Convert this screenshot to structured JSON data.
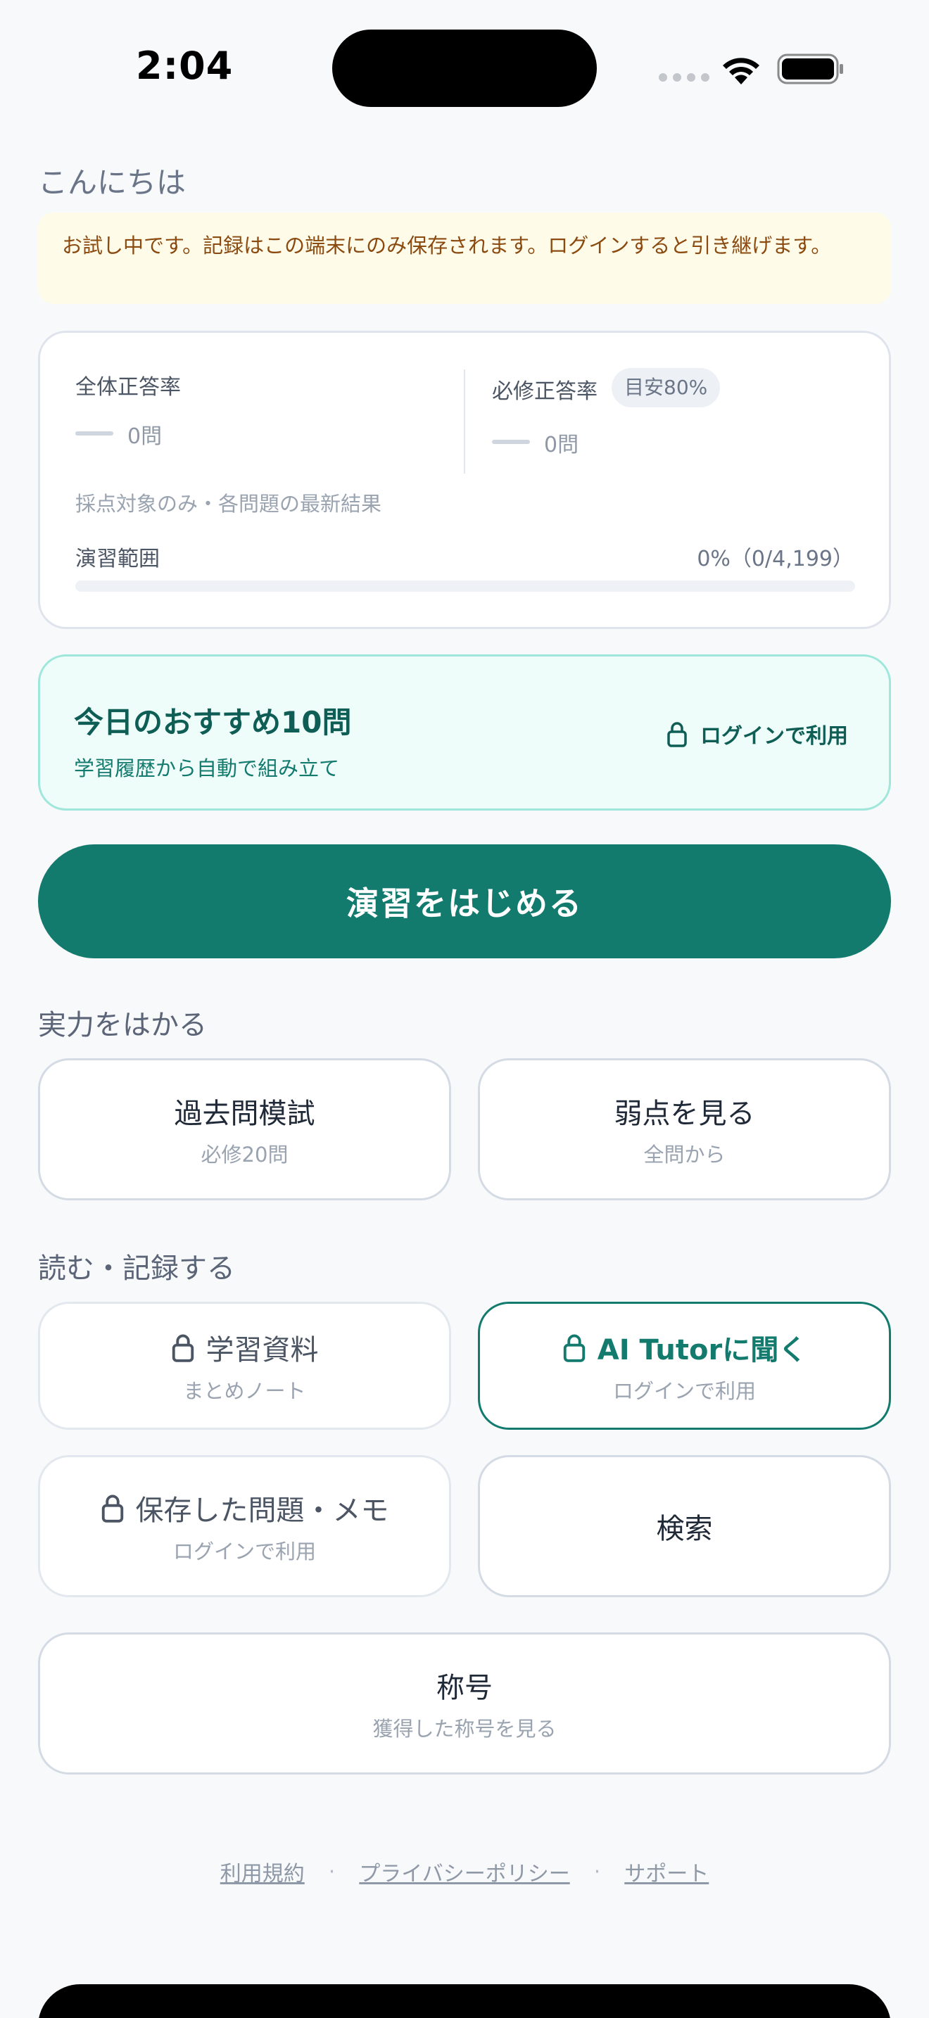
{
  "status_bar": {
    "time": "2:04"
  },
  "greeting": "こんにちは",
  "notice": "お試し中です。記録はこの端末にのみ保存されます。ログインすると引き継げます。",
  "stats": {
    "overall_label": "全体正答率",
    "overall_count": "0問",
    "required_label": "必修正答率",
    "goal_badge": "目安80%",
    "required_count": "0問",
    "note": "採点対象のみ・各問題の最新結果",
    "range_label": "演習範囲",
    "range_value": "0%（0/4,199）",
    "range_progress": 0
  },
  "recommend": {
    "title": "今日のおすすめ10問",
    "subtitle": "学習履歴から自動で組み立て",
    "lock_label": "ログインで利用"
  },
  "start_button": "演習をはじめる",
  "section_measure": {
    "title": "実力をはかる",
    "tiles": [
      {
        "title": "過去問模試",
        "sub": "必修20問"
      },
      {
        "title": "弱点を見る",
        "sub": "全問から"
      }
    ]
  },
  "section_read": {
    "title": "読む・記録する",
    "tiles": [
      {
        "title": "学習資料",
        "sub": "まとめノート"
      },
      {
        "title": "AI Tutorに聞く",
        "sub": "ログインで利用"
      },
      {
        "title": "保存した問題・メモ",
        "sub": "ログインで利用"
      },
      {
        "title": "検索"
      }
    ]
  },
  "titles_tile": {
    "title": "称号",
    "sub": "獲得した称号を見る"
  },
  "footer": {
    "terms": "利用規約",
    "privacy": "プライバシーポリシー",
    "support": "サポート",
    "separator": "·"
  },
  "colors": {
    "accent": "#137a6e",
    "notice_bg": "#fffbe9",
    "recommend_bg": "#eefcfa"
  }
}
